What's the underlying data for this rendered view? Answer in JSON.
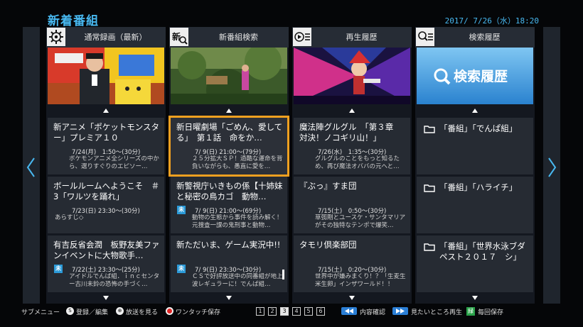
{
  "header": {
    "title": "新着番組",
    "datetime": "2017/ 7/26（水）18:20"
  },
  "columns": [
    {
      "title": "通常録画（最新）",
      "icon": "gear-icon",
      "thumbnail": "anime-host-thumbnail",
      "cards": [
        {
          "title": "新アニメ「ポケットモンスター」プレミア１０",
          "date": "7/24(月)　1:50～(30分)",
          "desc": "ポケモンアニメ全シリーズの中から、選りすぐりのエピソー…",
          "badge": ""
        },
        {
          "title": "ボールルームへようこそ　＃3「ワルツを踊れ」",
          "date": "7/23(日) 23:30～(30分)",
          "desc": "あらすじ◇",
          "badge": ""
        },
        {
          "title": "有吉反省会潤　板野友美ファンイベントに大物歌手…",
          "date": "7/22(土) 23:30～(25分)",
          "desc": "アイドルでんぱ組．ｉｎｃセンター古川未鈴の恐怖の手づく…",
          "badge": "未"
        }
      ]
    },
    {
      "title": "新番組検索",
      "icon": "new-search-icon",
      "icon_text": "新",
      "thumbnail": "forest-scene-thumbnail",
      "cards": [
        {
          "title": "新日曜劇場「ごめん、愛してる」　第１話　命をか…",
          "date": "7/ 9(日) 21:00～(79分)",
          "desc": "２５分拡大ＳＰ！過酷な運命を背負いながらも、愚直に愛を…",
          "badge": "",
          "selected": true
        },
        {
          "title": "新警視庁いきもの係【十姉妹と秘密の鳥カゴ　動物…",
          "date": "7/ 9(日) 21:00～(69分)",
          "desc": "動物の生態から事件を読み解く！元捜査一課の鬼刑事と動物…",
          "badge": "未"
        },
        {
          "title": "新ただいま、ゲーム実況中!!",
          "date": "7/ 9(日) 23:30～(30分)",
          "desc": "ＣＳで好評放送中の同番組が地上波レギュラーに！でんぱ組…",
          "badge": "未"
        }
      ]
    },
    {
      "title": "再生履歴",
      "icon": "play-list-icon",
      "thumbnail": "anime-character-thumbnail",
      "cards": [
        {
          "title": "魔法陣グルグル　「第３章　対決！ノコギリ山！」",
          "date": "7/26(水)　1:35～(30分)",
          "desc": "グルグルのことをもっと知るため、再び魔法オババの元へと…",
          "badge": ""
        },
        {
          "title": "『ぶっ』すま団",
          "date": "7/15(土)　0:50～(30分)",
          "desc": "草彅剛とユースケ・サンタマリアがその独特なテンポで爆笑…",
          "badge": ""
        },
        {
          "title": "タモリ倶楽部団",
          "date": "7/15(土)　0:20～(30分)",
          "desc": "世界中が嫌みまくり！？「生麦生米生卵」インザワールド！！",
          "badge": ""
        }
      ]
    },
    {
      "title": "検索履歴",
      "icon": "search-list-icon",
      "thumbnail": "search-history-thumbnail",
      "thumb_text": "検索履歴",
      "cards": [
        {
          "title": "「番組」「でんぱ組」"
        },
        {
          "title": "「番組」「ハライチ」"
        },
        {
          "title": "「番組」「世界水泳ブダペスト２０１７　シ」"
        }
      ]
    }
  ],
  "bottom": {
    "submenu": "サブメニュー",
    "register_label": "登録／編集",
    "watch_label": "放送を見る",
    "one_touch_label": "ワンタッチ保存",
    "pages": [
      "1",
      "2",
      "3",
      "4",
      "5",
      "6"
    ],
    "active_page": "3",
    "confirm_label": "内容確認",
    "skip_label": "見たいところ再生",
    "daily_label": "毎回保存",
    "s_key": "S",
    "enter_key": "⊕",
    "green_key": "緑"
  },
  "colors": {
    "accent": "#48b8f0",
    "selection": "#f0a020",
    "badge": "#2b9ad8"
  }
}
